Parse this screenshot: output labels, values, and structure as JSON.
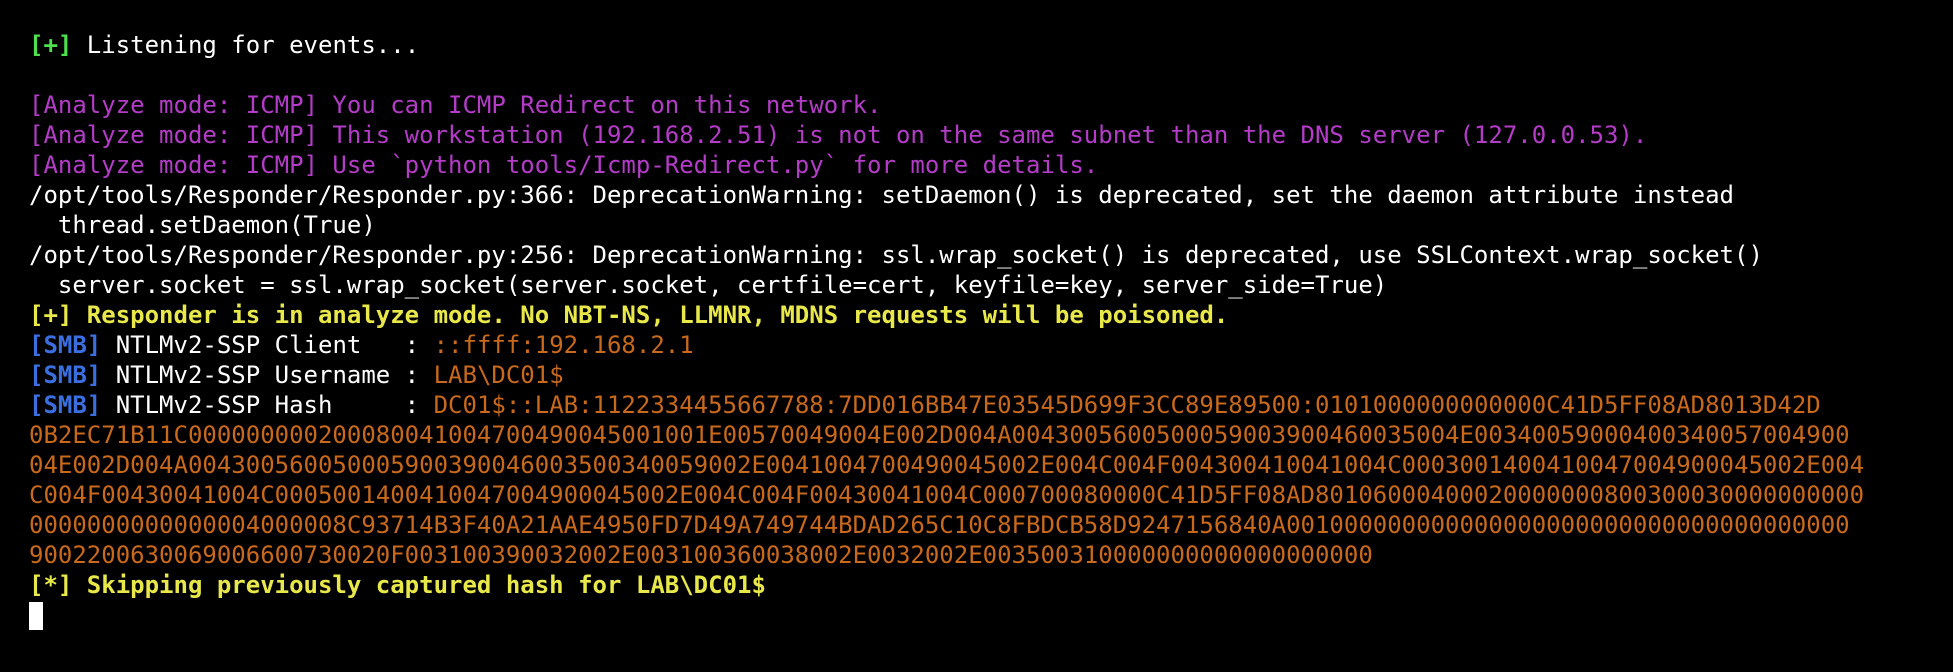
{
  "terminal": {
    "listening": {
      "prefix": "[+]",
      "text": " Listening for events..."
    },
    "analyze_lines": [
      "[Analyze mode: ICMP] You can ICMP Redirect on this network.",
      "[Analyze mode: ICMP] This workstation (192.168.2.51) is not on the same subnet than the DNS server (127.0.0.53).",
      "[Analyze mode: ICMP] Use `python tools/Icmp-Redirect.py` for more details."
    ],
    "warnings": [
      "/opt/tools/Responder/Responder.py:366: DeprecationWarning: setDaemon() is deprecated, set the daemon attribute instead",
      "  thread.setDaemon(True)",
      "/opt/tools/Responder/Responder.py:256: DeprecationWarning: ssl.wrap_socket() is deprecated, use SSLContext.wrap_socket()",
      "  server.socket = ssl.wrap_socket(server.socket, certfile=cert, keyfile=key, server_side=True)"
    ],
    "analyze_notice": "[+] Responder is in analyze mode. No NBT-NS, LLMNR, MDNS requests will be poisoned.",
    "smb": {
      "tag": "[SMB]",
      "client_label": " NTLMv2-SSP Client   : ",
      "client_value": "::ffff:192.168.2.1",
      "username_label": " NTLMv2-SSP Username : ",
      "username_value": "LAB\\DC01$",
      "hash_label": " NTLMv2-SSP Hash     : ",
      "hash_lines": [
        "DC01$::LAB:1122334455667788:7DD016BB47E03545D699F3CC89E89500:0101000000000000C41D5FF08AD8013D42D",
        "0B2EC71B11C000000000200080041004700490045001001E00570049004E002D004A0043005600500059003900460035004E00340059000400340057004900",
        "04E002D004A004300560050005900390046003500340059002E0041004700490045002E004C004F004300410041004C0003001400410047004900045002E004",
        "C004F00430041004C0005001400410047004900045002E004C004F00430041004C000700080000C41D5FF08AD80106000400020000000800300030000000000",
        "0000000000000004000008C93714B3F40A21AAE4950FD7D49A749744BDAD265C10C8FBDCB58D9247156840A001000000000000000000000000000000000000",
        "9002200630069006600730020F003100390032002E003100360038002E0032002E003500310000000000000000000"
      ]
    },
    "skip_notice": "[*] Skipping previously captured hash for LAB\\DC01$"
  },
  "colors": {
    "background": "#000000",
    "green": "#4fe04f",
    "magenta": "#b43cc8",
    "yellow": "#e8e84a",
    "blue": "#3b6fe0",
    "orange": "#c8691c"
  }
}
